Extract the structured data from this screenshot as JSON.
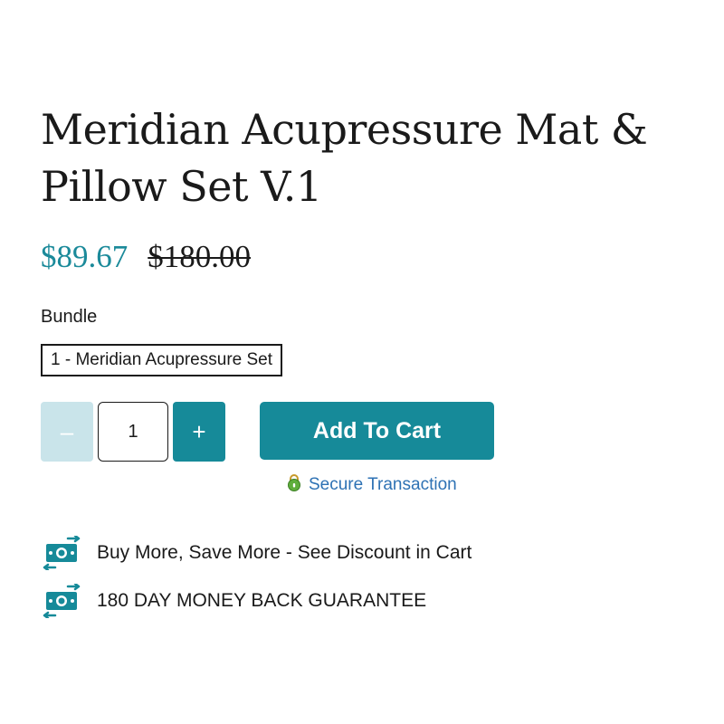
{
  "product": {
    "title": "Meridian Acupressure Mat & Pillow Set V.1",
    "sale_price": "$89.67",
    "original_price": "$180.00"
  },
  "bundle": {
    "label": "Bundle",
    "selected_option": "1 - Meridian Acupressure Set"
  },
  "quantity": {
    "minus_label": "–",
    "plus_label": "+",
    "value": "1"
  },
  "cart": {
    "add_label": "Add To Cart",
    "secure_label": "Secure Transaction"
  },
  "perks": [
    {
      "icon": "money-exchange-icon",
      "text": "Buy More, Save More - See Discount in Cart"
    },
    {
      "icon": "money-exchange-icon",
      "text": "180 DAY MONEY BACK GUARANTEE"
    }
  ],
  "colors": {
    "accent": "#168a99",
    "sale_price": "#1b8a9a",
    "disabled_button": "#c9e4ea",
    "secure_link": "#2e72b4"
  }
}
